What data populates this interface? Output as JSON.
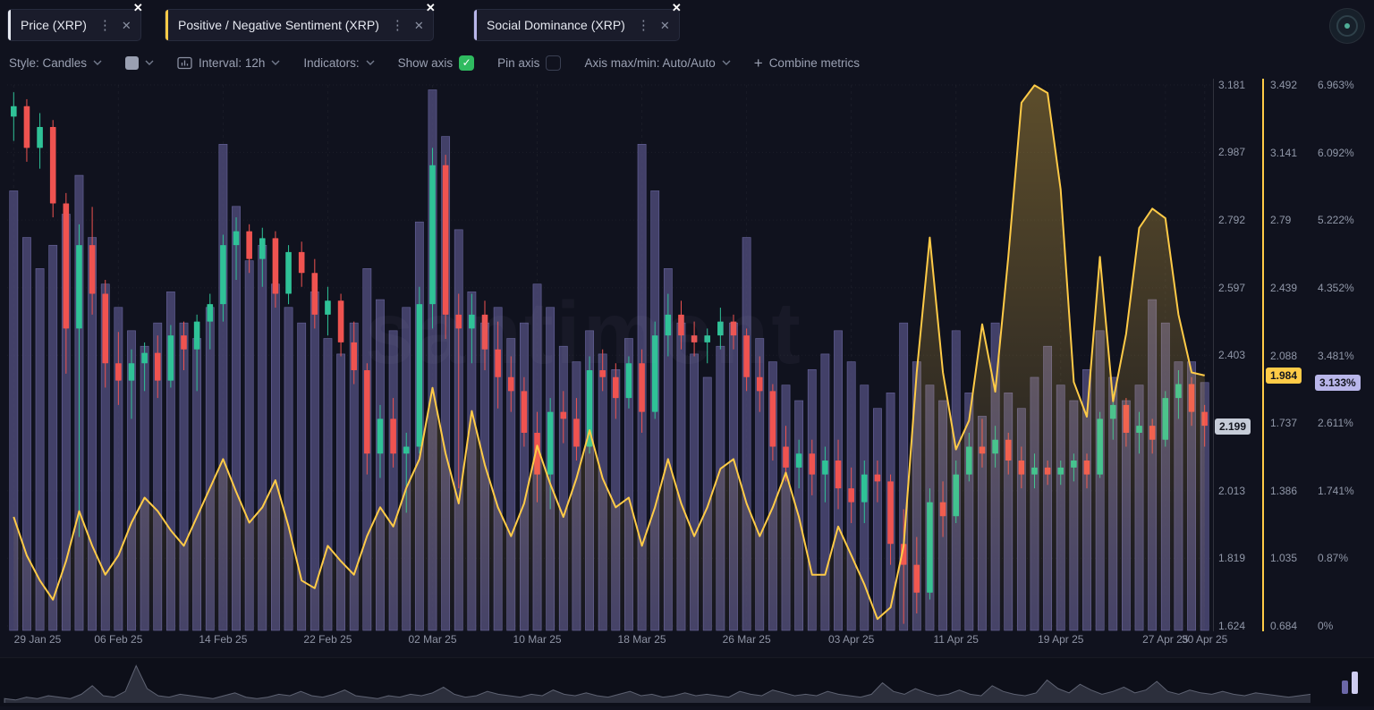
{
  "tabs": [
    {
      "label": "Price (XRP)",
      "accent": "#e6e9f0"
    },
    {
      "label": "Positive / Negative Sentiment (XRP)",
      "accent": "#ffcb47"
    },
    {
      "label": "Social Dominance (XRP)",
      "accent": "#b9b6ea"
    }
  ],
  "toolbar": {
    "style_label": "Style: Candles",
    "interval_label": "Interval: 12h",
    "indicators_label": "Indicators:",
    "show_axis_label": "Show axis",
    "pin_axis_label": "Pin axis",
    "axis_maxmin_label": "Axis max/min: Auto/Auto",
    "combine_plus": "+",
    "combine_label": "Combine metrics"
  },
  "watermark": "santiment",
  "colors": {
    "background": "#10121e",
    "candle_up": "#2fc297",
    "candle_down": "#ef5350",
    "sentiment_line": "#ffcb47",
    "dominance_bar": "#4f4c7b",
    "dominance_bar_edge": "#6f6ca6",
    "axis_text": "#9097a8",
    "price_badge_bg": "#c6ccd8",
    "sentiment_badge_bg": "#ffcb47",
    "dominance_badge_bg": "#b9b6ea",
    "badge_text": "#14161f",
    "checkbox_on": "#2fbb60"
  },
  "chart_data": {
    "type": "mixed",
    "interval": "12h",
    "x_tick_labels": [
      "29 Jan 25",
      "06 Feb 25",
      "14 Feb 25",
      "22 Feb 25",
      "02 Mar 25",
      "10 Mar 25",
      "18 Mar 25",
      "26 Mar 25",
      "03 Apr 25",
      "11 Apr 25",
      "19 Apr 25",
      "27 Apr 25",
      "30 Apr 25"
    ],
    "x_tick_indices": [
      0,
      8,
      16,
      24,
      32,
      40,
      48,
      56,
      64,
      72,
      80,
      88,
      91
    ],
    "series": [
      {
        "name": "Price (XRP)",
        "type": "candlestick",
        "last_value": "2.199",
        "axis": {
          "min": 1.624,
          "max": 3.181,
          "ticks": [
            "3.181",
            "2.987",
            "2.792",
            "2.597",
            "2.403",
            "2.013",
            "1.819",
            "1.624"
          ]
        },
        "ohlc": [
          [
            3.09,
            3.16,
            3.02,
            3.12
          ],
          [
            3.12,
            3.14,
            2.96,
            3.0
          ],
          [
            3.0,
            3.1,
            2.94,
            3.06
          ],
          [
            3.06,
            3.08,
            2.8,
            2.84
          ],
          [
            2.84,
            2.87,
            2.35,
            2.48
          ],
          [
            2.48,
            2.78,
            1.88,
            2.72
          ],
          [
            2.72,
            2.83,
            2.52,
            2.58
          ],
          [
            2.58,
            2.62,
            2.31,
            2.38
          ],
          [
            2.38,
            2.47,
            2.26,
            2.33
          ],
          [
            2.33,
            2.42,
            2.22,
            2.38
          ],
          [
            2.38,
            2.44,
            2.3,
            2.41
          ],
          [
            2.41,
            2.46,
            2.28,
            2.33
          ],
          [
            2.33,
            2.49,
            2.31,
            2.46
          ],
          [
            2.46,
            2.5,
            2.36,
            2.42
          ],
          [
            2.42,
            2.52,
            2.3,
            2.5
          ],
          [
            2.5,
            2.58,
            2.42,
            2.55
          ],
          [
            2.55,
            2.75,
            2.5,
            2.72
          ],
          [
            2.72,
            2.8,
            2.62,
            2.76
          ],
          [
            2.76,
            2.78,
            2.64,
            2.68
          ],
          [
            2.68,
            2.77,
            2.6,
            2.74
          ],
          [
            2.74,
            2.76,
            2.54,
            2.58
          ],
          [
            2.58,
            2.72,
            2.55,
            2.7
          ],
          [
            2.7,
            2.73,
            2.6,
            2.64
          ],
          [
            2.64,
            2.68,
            2.48,
            2.52
          ],
          [
            2.52,
            2.6,
            2.46,
            2.56
          ],
          [
            2.56,
            2.58,
            2.4,
            2.44
          ],
          [
            2.44,
            2.5,
            2.32,
            2.36
          ],
          [
            2.36,
            2.38,
            2.06,
            2.12
          ],
          [
            2.12,
            2.26,
            2.05,
            2.22
          ],
          [
            2.22,
            2.28,
            2.08,
            2.12
          ],
          [
            2.12,
            2.18,
            1.95,
            2.14
          ],
          [
            2.14,
            2.6,
            2.12,
            2.55
          ],
          [
            2.55,
            3.0,
            2.48,
            2.95
          ],
          [
            2.95,
            2.98,
            2.45,
            2.52
          ],
          [
            2.52,
            2.58,
            2.02,
            2.48
          ],
          [
            2.48,
            2.58,
            2.38,
            2.52
          ],
          [
            2.52,
            2.56,
            2.36,
            2.42
          ],
          [
            2.42,
            2.5,
            2.25,
            2.34
          ],
          [
            2.34,
            2.4,
            2.24,
            2.3
          ],
          [
            2.3,
            2.34,
            2.14,
            2.18
          ],
          [
            2.18,
            2.24,
            1.98,
            2.06
          ],
          [
            2.06,
            2.28,
            1.96,
            2.24
          ],
          [
            2.24,
            2.3,
            2.15,
            2.22
          ],
          [
            2.22,
            2.28,
            2.1,
            2.14
          ],
          [
            2.14,
            2.4,
            2.12,
            2.36
          ],
          [
            2.36,
            2.42,
            2.3,
            2.34
          ],
          [
            2.34,
            2.38,
            2.22,
            2.28
          ],
          [
            2.28,
            2.4,
            2.25,
            2.38
          ],
          [
            2.38,
            2.42,
            2.18,
            2.24
          ],
          [
            2.24,
            2.5,
            2.22,
            2.46
          ],
          [
            2.46,
            2.58,
            2.4,
            2.52
          ],
          [
            2.52,
            2.56,
            2.42,
            2.46
          ],
          [
            2.46,
            2.5,
            2.4,
            2.44
          ],
          [
            2.44,
            2.48,
            2.38,
            2.46
          ],
          [
            2.46,
            2.54,
            2.42,
            2.5
          ],
          [
            2.5,
            2.52,
            2.42,
            2.46
          ],
          [
            2.46,
            2.48,
            2.3,
            2.34
          ],
          [
            2.34,
            2.4,
            2.24,
            2.3
          ],
          [
            2.3,
            2.32,
            2.1,
            2.14
          ],
          [
            2.14,
            2.2,
            2.04,
            2.08
          ],
          [
            2.08,
            2.16,
            2.02,
            2.12
          ],
          [
            2.12,
            2.16,
            2.0,
            2.06
          ],
          [
            2.06,
            2.14,
            1.98,
            2.1
          ],
          [
            2.1,
            2.16,
            1.96,
            2.02
          ],
          [
            2.02,
            2.08,
            1.92,
            1.98
          ],
          [
            1.98,
            2.1,
            1.92,
            2.06
          ],
          [
            2.06,
            2.1,
            1.98,
            2.04
          ],
          [
            2.04,
            2.06,
            1.8,
            1.86
          ],
          [
            1.86,
            1.96,
            1.63,
            1.8
          ],
          [
            1.8,
            1.88,
            1.66,
            1.72
          ],
          [
            1.72,
            2.02,
            1.7,
            1.98
          ],
          [
            1.98,
            2.04,
            1.88,
            1.94
          ],
          [
            1.94,
            2.1,
            1.92,
            2.06
          ],
          [
            2.06,
            2.18,
            2.04,
            2.14
          ],
          [
            2.14,
            2.22,
            2.08,
            2.12
          ],
          [
            2.12,
            2.2,
            2.08,
            2.16
          ],
          [
            2.16,
            2.18,
            2.06,
            2.1
          ],
          [
            2.1,
            2.14,
            2.02,
            2.06
          ],
          [
            2.06,
            2.12,
            2.02,
            2.08
          ],
          [
            2.08,
            2.1,
            2.03,
            2.06
          ],
          [
            2.06,
            2.1,
            2.03,
            2.08
          ],
          [
            2.08,
            2.12,
            2.04,
            2.1
          ],
          [
            2.1,
            2.12,
            2.02,
            2.06
          ],
          [
            2.06,
            2.24,
            2.05,
            2.22
          ],
          [
            2.22,
            2.3,
            2.16,
            2.26
          ],
          [
            2.26,
            2.28,
            2.14,
            2.18
          ],
          [
            2.18,
            2.24,
            2.12,
            2.2
          ],
          [
            2.2,
            2.22,
            2.12,
            2.16
          ],
          [
            2.16,
            2.3,
            2.14,
            2.28
          ],
          [
            2.28,
            2.36,
            2.22,
            2.32
          ],
          [
            2.32,
            2.34,
            2.2,
            2.24
          ],
          [
            2.24,
            2.26,
            2.14,
            2.2
          ]
        ]
      },
      {
        "name": "Positive / Negative Sentiment (XRP)",
        "type": "line",
        "last_value": "1.984",
        "axis": {
          "min": 0.684,
          "max": 3.492,
          "ticks": [
            "3.492",
            "3.141",
            "2.79",
            "2.439",
            "2.088",
            "1.737",
            "1.386",
            "1.035",
            "0.684"
          ]
        },
        "values": [
          1.25,
          1.05,
          0.92,
          0.82,
          1.02,
          1.28,
          1.1,
          0.95,
          1.05,
          1.22,
          1.35,
          1.28,
          1.18,
          1.1,
          1.25,
          1.4,
          1.55,
          1.38,
          1.22,
          1.3,
          1.44,
          1.2,
          0.92,
          0.88,
          1.1,
          1.02,
          0.95,
          1.15,
          1.3,
          1.2,
          1.4,
          1.55,
          1.92,
          1.58,
          1.32,
          1.8,
          1.52,
          1.3,
          1.15,
          1.32,
          1.62,
          1.42,
          1.25,
          1.45,
          1.7,
          1.45,
          1.3,
          1.35,
          1.1,
          1.3,
          1.55,
          1.32,
          1.15,
          1.3,
          1.5,
          1.55,
          1.32,
          1.15,
          1.3,
          1.48,
          1.25,
          0.95,
          0.95,
          1.2,
          1.05,
          0.9,
          0.72,
          0.78,
          1.1,
          2.0,
          2.7,
          2.0,
          1.6,
          1.75,
          2.25,
          1.9,
          2.6,
          3.4,
          3.49,
          3.45,
          2.95,
          1.95,
          1.77,
          2.6,
          1.85,
          2.2,
          2.75,
          2.85,
          2.8,
          2.3,
          2.0,
          1.984
        ]
      },
      {
        "name": "Social Dominance (XRP)",
        "type": "bar",
        "last_value": "3.133%",
        "axis": {
          "min": 0,
          "max": 6.963,
          "ticks": [
            "6.963%",
            "6.092%",
            "5.222%",
            "4.352%",
            "3.481%",
            "2.611%",
            "1.741%",
            "0.87%",
            "0%"
          ]
        },
        "values": [
          5.6,
          5.0,
          4.6,
          4.9,
          5.3,
          5.8,
          5.0,
          4.4,
          4.1,
          3.8,
          3.6,
          3.9,
          4.3,
          3.9,
          3.7,
          4.1,
          6.2,
          5.4,
          4.7,
          4.9,
          4.4,
          4.1,
          3.9,
          4.3,
          3.7,
          3.5,
          3.9,
          4.6,
          4.2,
          3.8,
          4.1,
          5.2,
          6.9,
          6.3,
          5.1,
          4.3,
          3.9,
          4.1,
          3.7,
          3.9,
          4.4,
          4.1,
          3.6,
          3.4,
          3.8,
          3.5,
          3.3,
          3.7,
          6.2,
          5.6,
          4.6,
          3.9,
          3.5,
          3.2,
          3.6,
          3.9,
          5.0,
          3.7,
          3.4,
          3.1,
          2.9,
          3.3,
          3.5,
          3.8,
          3.4,
          3.1,
          2.8,
          3.0,
          3.9,
          3.4,
          3.1,
          2.9,
          3.8,
          3.0,
          2.7,
          3.9,
          3.0,
          2.8,
          3.2,
          3.6,
          3.1,
          2.9,
          3.3,
          3.8,
          3.2,
          2.9,
          3.1,
          4.2,
          3.9,
          3.4,
          3.4,
          3.133
        ]
      }
    ],
    "preview_values": [
      0.3,
      0.2,
      0.4,
      0.3,
      0.5,
      0.4,
      0.3,
      0.6,
      1.2,
      0.5,
      0.4,
      0.8,
      2.6,
      1.0,
      0.5,
      0.4,
      0.6,
      0.5,
      0.4,
      0.3,
      0.5,
      0.7,
      0.4,
      0.3,
      0.4,
      0.6,
      0.5,
      0.8,
      0.5,
      0.4,
      0.6,
      0.9,
      0.5,
      0.4,
      0.3,
      0.5,
      0.4,
      0.6,
      0.5,
      0.7,
      1.1,
      0.6,
      0.4,
      0.5,
      0.8,
      0.6,
      0.5,
      0.4,
      0.6,
      0.5,
      0.9,
      0.6,
      0.5,
      0.7,
      0.5,
      0.4,
      0.6,
      0.8,
      0.5,
      0.6,
      0.4,
      0.5,
      0.7,
      0.5,
      0.6,
      0.5,
      0.4,
      0.8,
      0.6,
      0.5,
      0.9,
      0.7,
      0.5,
      0.6,
      0.5,
      0.8,
      0.6,
      0.5,
      0.4,
      0.6,
      1.4,
      0.8,
      0.6,
      1.0,
      0.7,
      0.5,
      0.6,
      0.9,
      0.6,
      0.5,
      1.2,
      0.8,
      0.6,
      0.5,
      0.7,
      1.6,
      1.0,
      0.7,
      1.3,
      0.9,
      0.6,
      0.8,
      1.1,
      0.7,
      0.9,
      1.5,
      0.8,
      0.6,
      0.9,
      0.7,
      0.6,
      0.8,
      0.6,
      0.5,
      0.7,
      0.6,
      0.5,
      0.4,
      0.5,
      0.6
    ]
  }
}
